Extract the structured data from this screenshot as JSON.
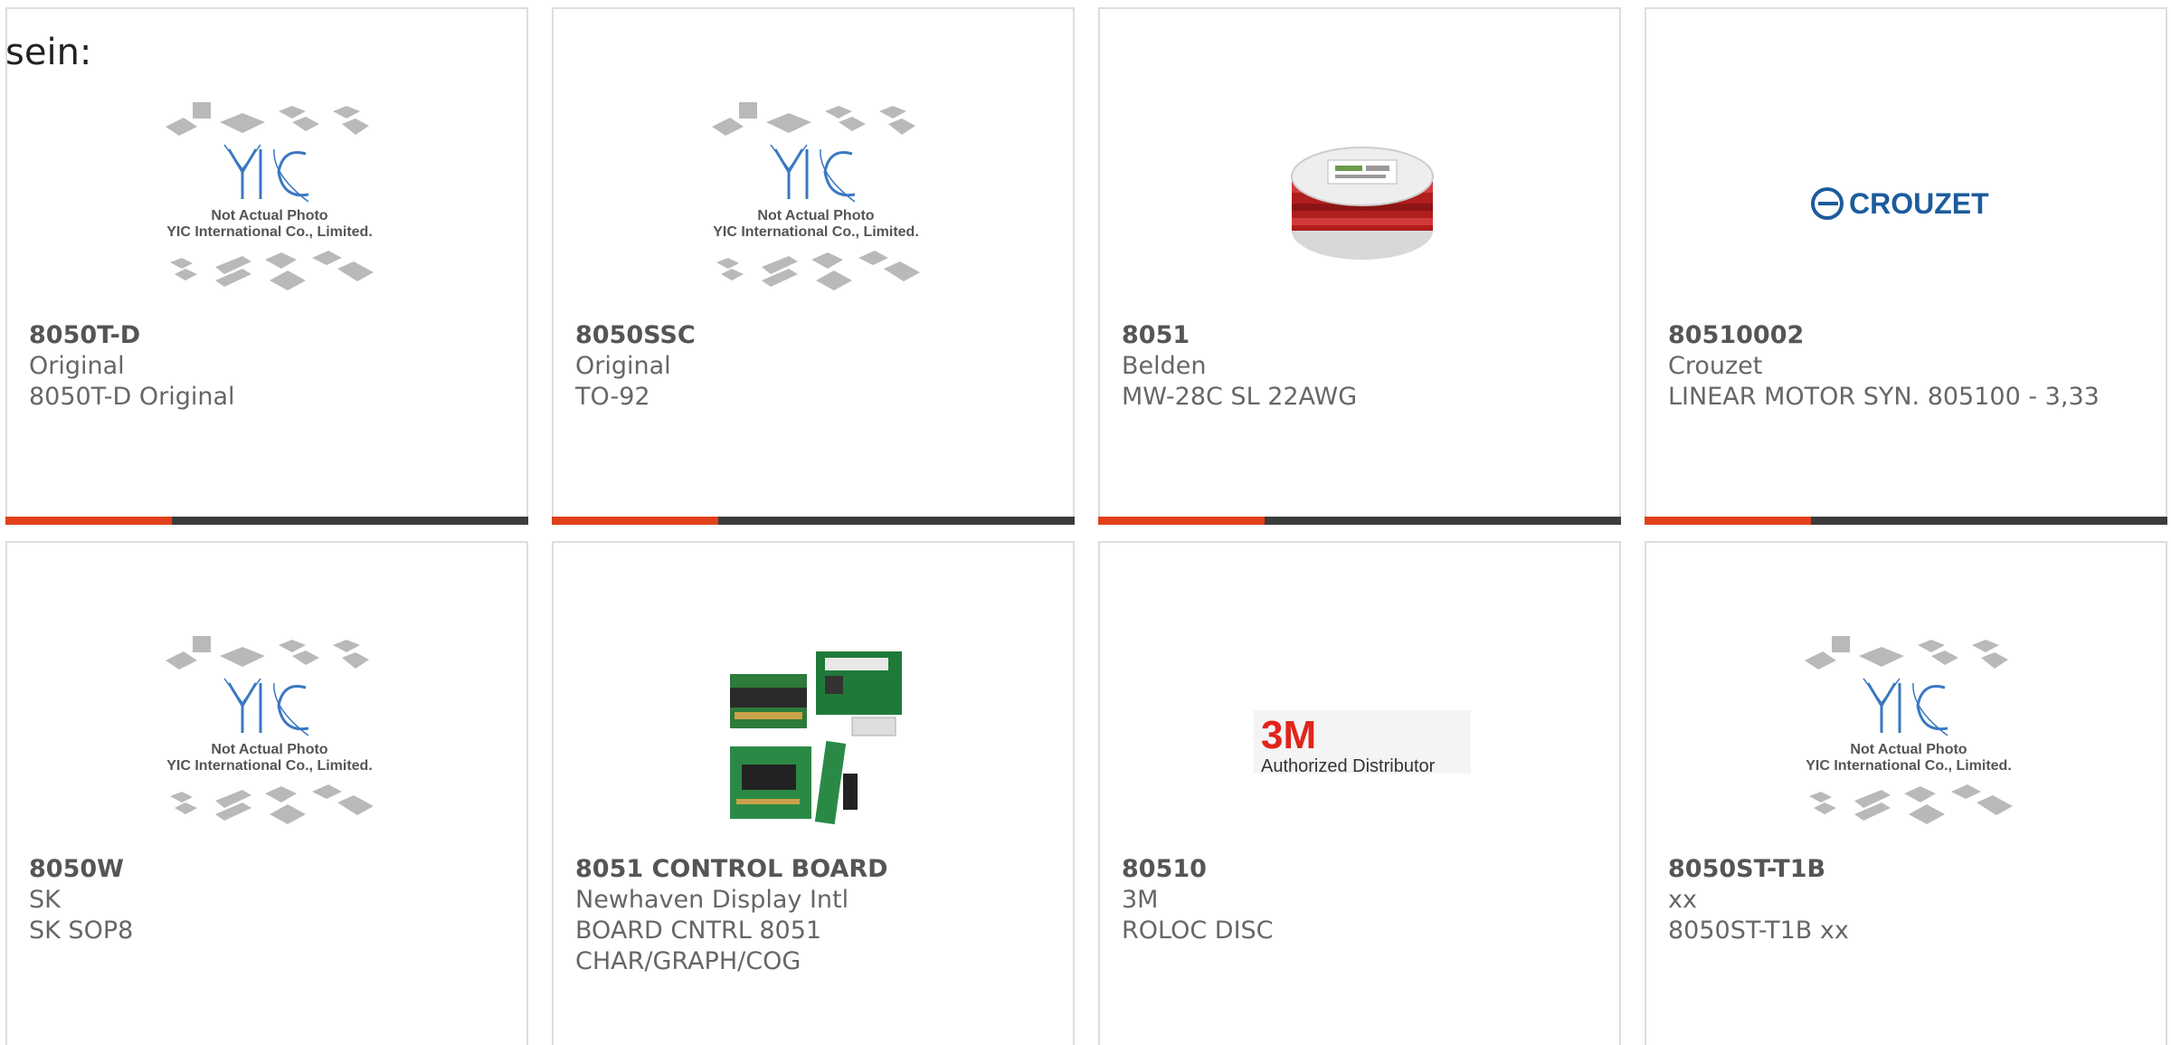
{
  "intro_text": "sein:",
  "colors": {
    "accent": "#e0401a",
    "bar": "#3c3c3c",
    "card_border": "#dddddd",
    "text": "#666666",
    "yic_blue": "#3a78c2",
    "crouzet_blue": "#1c5c9c",
    "brand_3m_red": "#e1251b"
  },
  "placeholder": {
    "line1": "Not Actual Photo",
    "line2": "YIC International Co., Limited."
  },
  "crouzet_logo_text": "CROUZET",
  "authorized_text": "Authorized Distributor",
  "products": [
    {
      "part_number": "8050T-D",
      "manufacturer": "Original",
      "description": "8050T-D Original",
      "image": "yic-placeholder"
    },
    {
      "part_number": "8050SSC",
      "manufacturer": "Original",
      "description": "TO-92",
      "image": "yic-placeholder"
    },
    {
      "part_number": "8051",
      "manufacturer": "Belden",
      "description": "MW-28C SL 22AWG",
      "image": "wire-spool"
    },
    {
      "part_number": "80510002",
      "manufacturer": "Crouzet",
      "description": "LINEAR MOTOR SYN. 805100 - 3,33",
      "image": "crouzet-logo"
    },
    {
      "part_number": "8050W",
      "manufacturer": "SK",
      "description": "SK SOP8",
      "image": "yic-placeholder"
    },
    {
      "part_number": "8051 CONTROL BOARD",
      "manufacturer": "Newhaven Display Intl",
      "description": "BOARD CNTRL 8051 CHAR/GRAPH/COG",
      "image": "control-boards"
    },
    {
      "part_number": "80510",
      "manufacturer": "3M",
      "description": "ROLOC DISC",
      "image": "3m-logo"
    },
    {
      "part_number": "8050ST-T1B",
      "manufacturer": "xx",
      "description": "8050ST-T1B xx",
      "image": "yic-placeholder"
    }
  ]
}
